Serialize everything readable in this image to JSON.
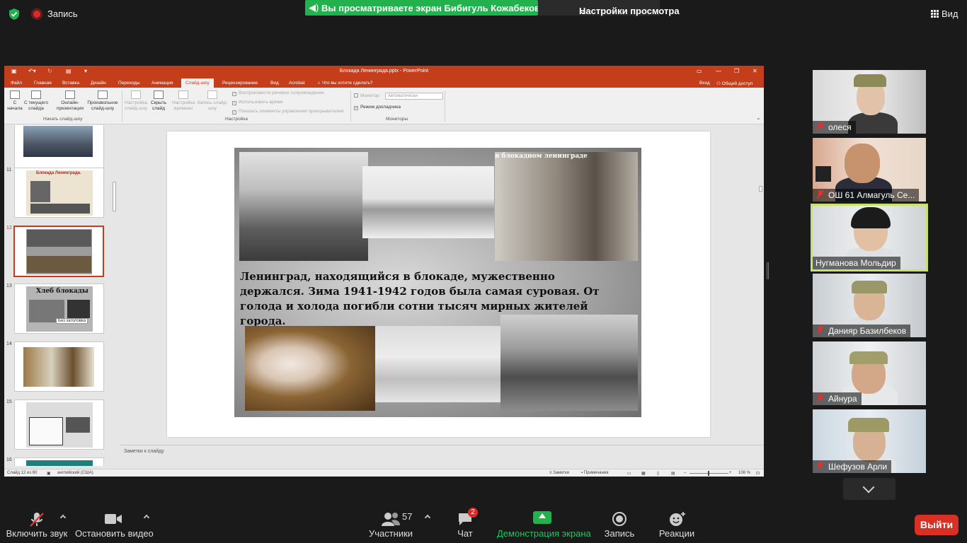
{
  "topbar": {
    "recording_label": "Запись",
    "share_banner": "Вы просматриваете экран Бибигуль Кожабековна",
    "view_settings": "Настройки просмотра",
    "view_label": "Вид"
  },
  "ppt": {
    "title": "Блокада Ленинграда.pptx - PowerPoint",
    "signin": "Вход",
    "share": "Общий доступ",
    "tabs": [
      "Файл",
      "Главная",
      "Вставка",
      "Дизайн",
      "Переходы",
      "Анимация",
      "Слайд-шоу",
      "Рецензирование",
      "Вид",
      "Acrobat"
    ],
    "active_tab": "Слайд-шоу",
    "tell_me": "Что вы хотите сделать?",
    "ribbon": {
      "from_start": "С начала",
      "from_current": "С текущего слайда",
      "online": "Онлайн-презентация",
      "custom": "Произвольное слайд-шоу",
      "group_start": "Начать слайд-шоу",
      "setup": "Настройка слайд-шоу",
      "hide": "Скрыть слайд",
      "rehearse": "Настройка времени",
      "record": "Запись слайд-шоу",
      "chk_narration": "Воспроизвести речевое сопровождение",
      "chk_timings": "Использовать время",
      "chk_controls": "Показать элементы управления проигрывателем",
      "group_setup": "Настройка",
      "monitor_label": "Монитор:",
      "monitor_value": "Автоматически",
      "presenter_view": "Режим докладчика",
      "group_monitors": "Мониторы"
    },
    "thumbs": [
      {
        "num": "11",
        "title": "Блокада Ленинграда."
      },
      {
        "num": "12"
      },
      {
        "num": "13",
        "title": "Хлеб блокады",
        "tooltip": "Без заголовка"
      },
      {
        "num": "14"
      },
      {
        "num": "15"
      },
      {
        "num": "16"
      }
    ],
    "slide": {
      "caption": "в блокадном ленинграде",
      "text": "Ленинград, находящийся в блокаде, мужественно держался. Зима 1941-1942 годов была самая суровая. От голода и холода погибли сотни тысяч мирных жителей города."
    },
    "notes_placeholder": "Заметки к слайду",
    "status": {
      "slide_of": "Слайд 12 из 60",
      "language": "английский (США)",
      "notes": "Заметки",
      "comments": "Примечания",
      "zoom": "108 %"
    }
  },
  "participants": [
    {
      "name": "олеся",
      "muted": true
    },
    {
      "name": "ОШ 61 Алмагуль Се...",
      "muted": true
    },
    {
      "name": "Нугманова Мольдир",
      "muted": false,
      "active": true
    },
    {
      "name": "Данияр Базилбеков",
      "muted": true
    },
    {
      "name": "Айнура",
      "muted": true
    },
    {
      "name": "Шефузов Арли",
      "muted": true
    }
  ],
  "toolbar": {
    "unmute": "Включить звук",
    "stop_video": "Остановить видео",
    "participants": "Участники",
    "participants_count": "57",
    "chat": "Чат",
    "chat_badge": "2",
    "share_screen": "Демонстрация экрана",
    "record": "Запись",
    "reactions": "Реакции",
    "leave": "Выйти"
  },
  "colors": {
    "ppt_accent": "#c43e1c",
    "share_green": "#22b14c",
    "active_speaker": "#c7e26b",
    "leave_red": "#d93025"
  }
}
